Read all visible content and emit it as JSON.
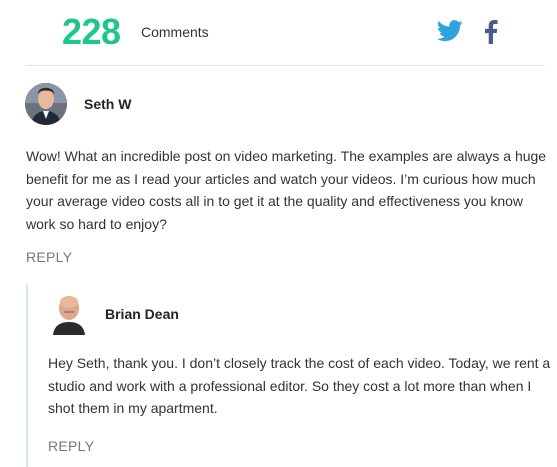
{
  "comments_header": {
    "count": "228",
    "label": "Comments",
    "social": [
      "twitter-icon",
      "facebook-icon"
    ],
    "accent_color": "#1fc68a",
    "twitter_color": "#2da3e0",
    "facebook_color": "#4a5a8a"
  },
  "comments": [
    {
      "author": "Seth W",
      "text": "Wow! What an incredible post on video marketing. The examples are always a huge benefit for me as I read your articles and watch your videos. I’m curious how much your average video costs all in to get it at the quality and effectiveness you know work so hard to enjoy?",
      "reply_label": "REPLY"
    },
    {
      "author": "Brian Dean",
      "text": "Hey Seth, thank you. I don’t closely track the cost of each video. Today, we rent a studio and work with a professional editor. So they cost a lot more than when I shot them in my apartment.",
      "reply_label": "REPLY"
    }
  ]
}
